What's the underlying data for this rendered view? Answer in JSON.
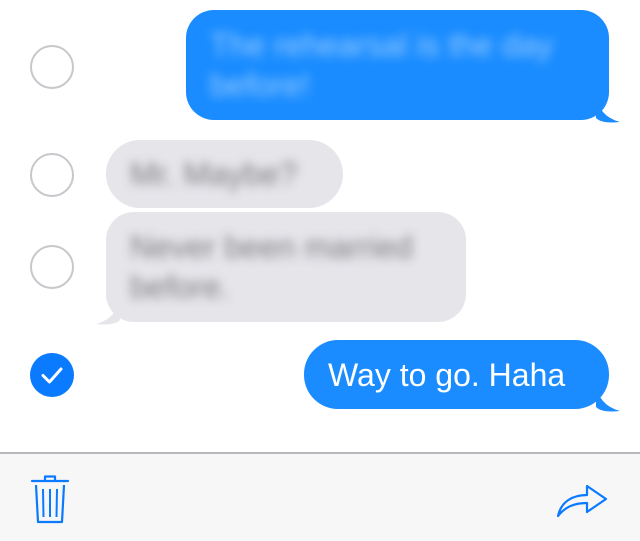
{
  "colors": {
    "sent_bubble": "#1a8cff",
    "received_bubble": "#e5e5ea",
    "accent": "#0a7aff",
    "unchecked_circle": "#c7c7cc",
    "toolbar_bg": "#f7f7f8"
  },
  "messages": [
    {
      "direction": "sent",
      "text": "The rehearsal is the day before!",
      "blurred": true,
      "selected": false
    },
    {
      "direction": "received",
      "text": "Mr. Maybe?",
      "blurred": true,
      "selected": false
    },
    {
      "direction": "received",
      "text": "Never been married before.",
      "blurred": true,
      "selected": false
    },
    {
      "direction": "sent",
      "text": "Way to go. Haha",
      "blurred": false,
      "selected": true
    }
  ],
  "toolbar": {
    "delete_icon": "trash-icon",
    "forward_icon": "forward-arrow-icon"
  }
}
